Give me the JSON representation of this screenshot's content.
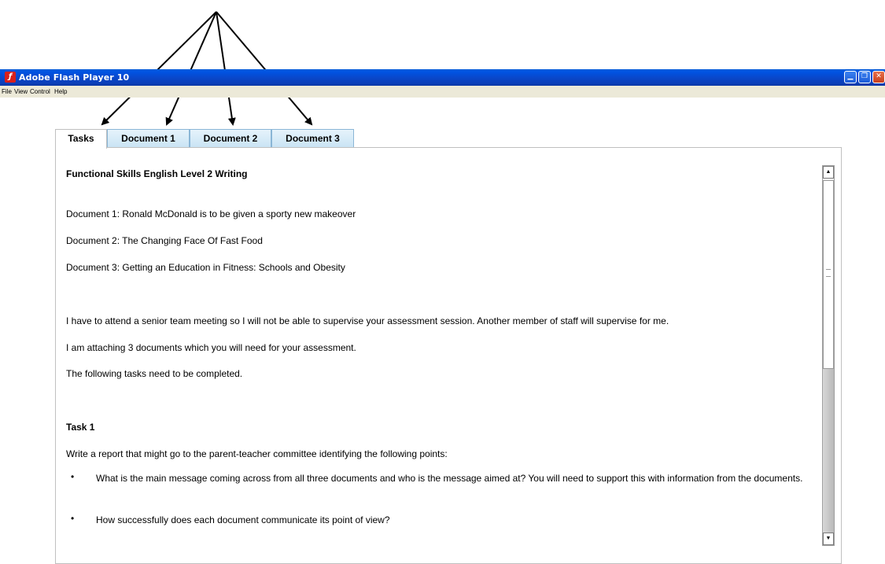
{
  "window": {
    "title": "Adobe Flash Player 10",
    "buttons": {
      "minimize_icon": "minimize-icon",
      "restore_icon": "restore-icon",
      "close_icon": "close-icon"
    }
  },
  "menu": [
    "File",
    "View",
    "Control",
    "Help"
  ],
  "tabs": [
    {
      "label": "Tasks",
      "active": true
    },
    {
      "label": "Document 1",
      "active": false
    },
    {
      "label": "Document 2",
      "active": false
    },
    {
      "label": "Document 3",
      "active": false
    }
  ],
  "content": {
    "heading": "Functional Skills English Level 2 Writing",
    "documents": [
      "Document 1: Ronald McDonald is to be given a sporty new makeover",
      "Document 2: The Changing Face Of Fast Food",
      "Document 3: Getting an Education in Fitness: Schools and Obesity"
    ],
    "paragraphs": [
      "I have to attend a senior team meeting so I will not be able to supervise your assessment session.  Another member of staff will supervise for me.",
      "I am attaching 3 documents which you will need for your assessment.",
      "The following tasks need to be completed."
    ],
    "task1": {
      "title": "Task 1",
      "intro": "Write a report that might go to the parent-teacher committee identifying the following points:",
      "bullets": [
        "What is the main message coming across from all three documents and who is the message aimed at? You will need to support this with information from the documents.",
        "How successfully does each document communicate its point of view?"
      ]
    }
  },
  "colors": {
    "titlebar": "#0a46c8",
    "menubar": "#ece9d8",
    "tab_inactive": "#c8e3f4",
    "close_button": "#c8401c"
  }
}
